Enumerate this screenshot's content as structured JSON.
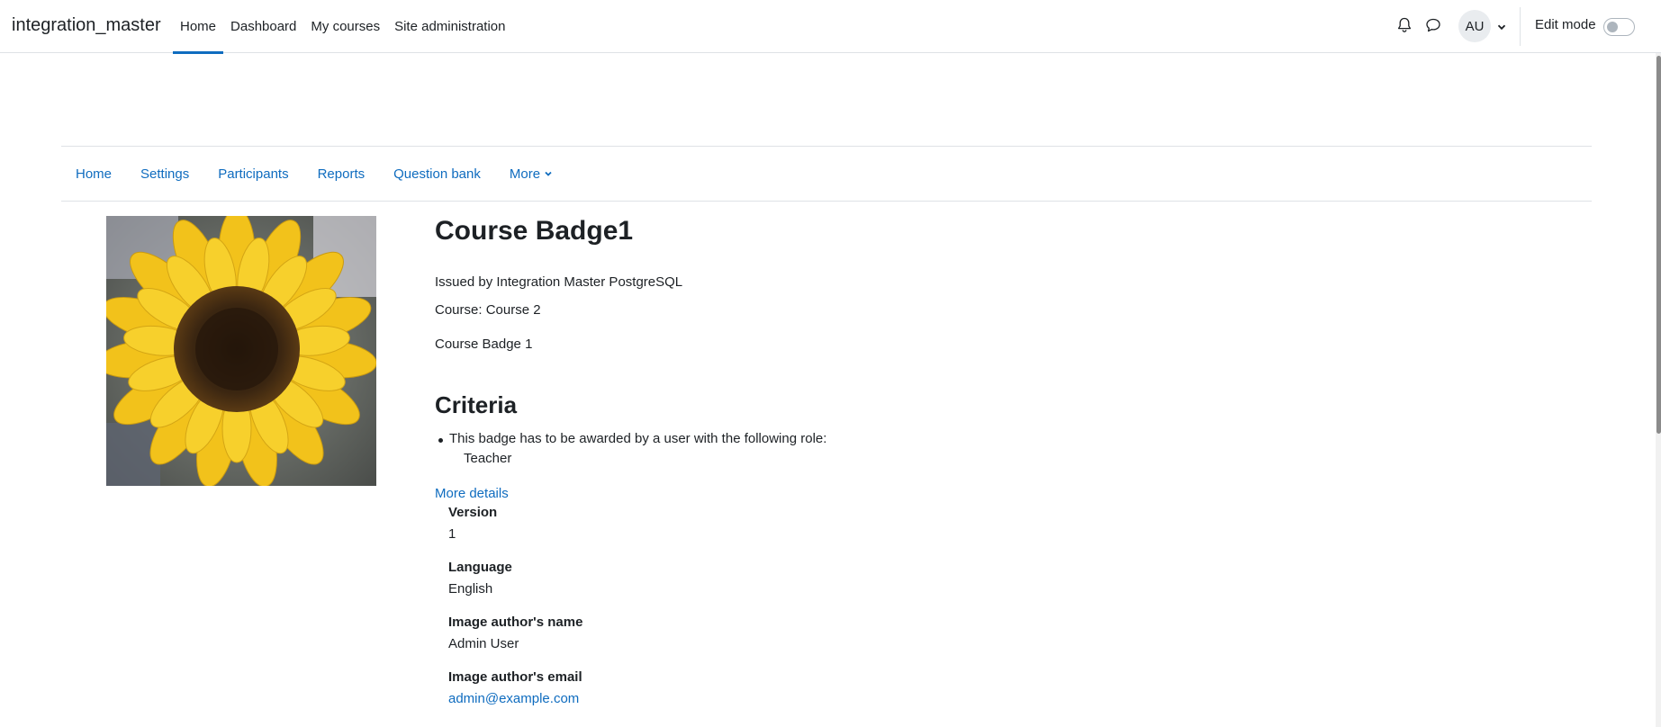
{
  "site": {
    "brand": "integration_master"
  },
  "primary_nav": [
    {
      "label": "Home",
      "active": true
    },
    {
      "label": "Dashboard",
      "active": false
    },
    {
      "label": "My courses",
      "active": false
    },
    {
      "label": "Site administration",
      "active": false
    }
  ],
  "user": {
    "initials": "AU",
    "edit_mode_label": "Edit mode",
    "edit_mode_on": false
  },
  "secondary_nav": [
    "Home",
    "Settings",
    "Participants",
    "Reports",
    "Question bank",
    "More"
  ],
  "badge": {
    "title": "Course Badge1",
    "issued_by": "Issued by Integration Master PostgreSQL",
    "course": "Course: Course 2",
    "description": "Course Badge 1",
    "image_icon": "sunflower-image"
  },
  "criteria": {
    "title": "Criteria",
    "items": [
      {
        "text": "This badge has to be awarded by a user with the following role:",
        "role": "Teacher"
      }
    ]
  },
  "details": {
    "link_label": "More details",
    "fields": [
      {
        "label": "Version",
        "value": "1"
      },
      {
        "label": "Language",
        "value": "English"
      },
      {
        "label": "Image author's name",
        "value": "Admin User"
      },
      {
        "label": "Image author's email",
        "value": "admin@example.com"
      }
    ]
  },
  "colors": {
    "link": "#0f6cbf",
    "text": "#1d2125",
    "border": "#dee2e6"
  }
}
